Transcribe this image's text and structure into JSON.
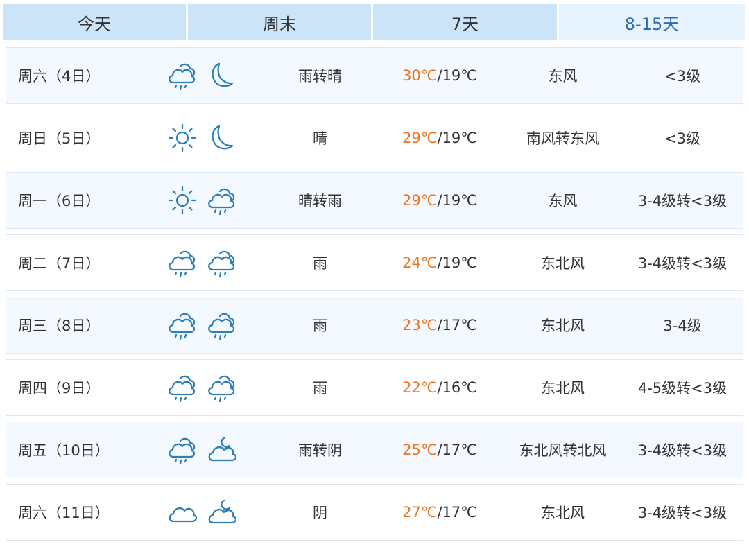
{
  "tabs": [
    {
      "label": "今天",
      "active": false
    },
    {
      "label": "周末",
      "active": false
    },
    {
      "label": "7天",
      "active": false
    },
    {
      "label": "8-15天",
      "active": true
    }
  ],
  "colors": {
    "tab_bg": "#cce4f8",
    "tab_active_bg": "#e6f2fc",
    "tab_active_text": "#2c6cb7",
    "row_alt_bg": "#f3f9fe",
    "high_temp": "#ee7521",
    "icon": "#2e7fb6"
  },
  "forecast": [
    {
      "day": "周六（4日）",
      "icon_day": "rain-icon",
      "icon_night": "moon-icon",
      "weather": "雨转晴",
      "high": "30℃",
      "low": "19℃",
      "wind": "东风",
      "level": "<3级"
    },
    {
      "day": "周日（5日）",
      "icon_day": "sun-icon",
      "icon_night": "moon-icon",
      "weather": "晴",
      "high": "29℃",
      "low": "19℃",
      "wind": "南风转东风",
      "level": "<3级"
    },
    {
      "day": "周一（6日）",
      "icon_day": "sun-icon",
      "icon_night": "rain-icon",
      "weather": "晴转雨",
      "high": "29℃",
      "low": "19℃",
      "wind": "东风",
      "level": "3-4级转<3级"
    },
    {
      "day": "周二（7日）",
      "icon_day": "rain-icon",
      "icon_night": "rain-icon",
      "weather": "雨",
      "high": "24℃",
      "low": "19℃",
      "wind": "东北风",
      "level": "3-4级转<3级"
    },
    {
      "day": "周三（8日）",
      "icon_day": "rain-icon",
      "icon_night": "rain-icon",
      "weather": "雨",
      "high": "23℃",
      "low": "17℃",
      "wind": "东北风",
      "level": "3-4级"
    },
    {
      "day": "周四（9日）",
      "icon_day": "rain-icon",
      "icon_night": "rain-icon",
      "weather": "雨",
      "high": "22℃",
      "low": "16℃",
      "wind": "东北风",
      "level": "4-5级转<3级"
    },
    {
      "day": "周五（10日）",
      "icon_day": "rain-icon",
      "icon_night": "cloudy-night-icon",
      "weather": "雨转阴",
      "high": "25℃",
      "low": "17℃",
      "wind": "东北风转北风",
      "level": "3-4级转<3级"
    },
    {
      "day": "周六（11日）",
      "icon_day": "cloud-icon",
      "icon_night": "cloudy-night-icon",
      "weather": "阴",
      "high": "27℃",
      "low": "17℃",
      "wind": "东北风",
      "level": "3-4级转<3级"
    }
  ],
  "temp_separator": "/"
}
